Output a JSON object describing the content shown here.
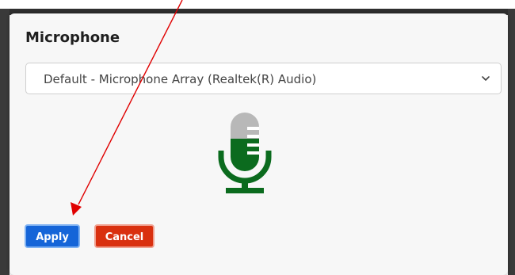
{
  "dialog": {
    "title": "Microphone",
    "device_select": {
      "selected": "Default - Microphone Array (Realtek(R) Audio)"
    },
    "apply_label": "Apply",
    "cancel_label": "Cancel"
  },
  "icons": {
    "mic": "microphone-icon",
    "chevron": "chevron-down-icon"
  },
  "colors": {
    "mic_green": "#0b6b1e",
    "mic_grey": "#b8b8b8",
    "apply_blue": "#1565d8",
    "cancel_red": "#d9300f",
    "annotation_red": "#e00000"
  }
}
